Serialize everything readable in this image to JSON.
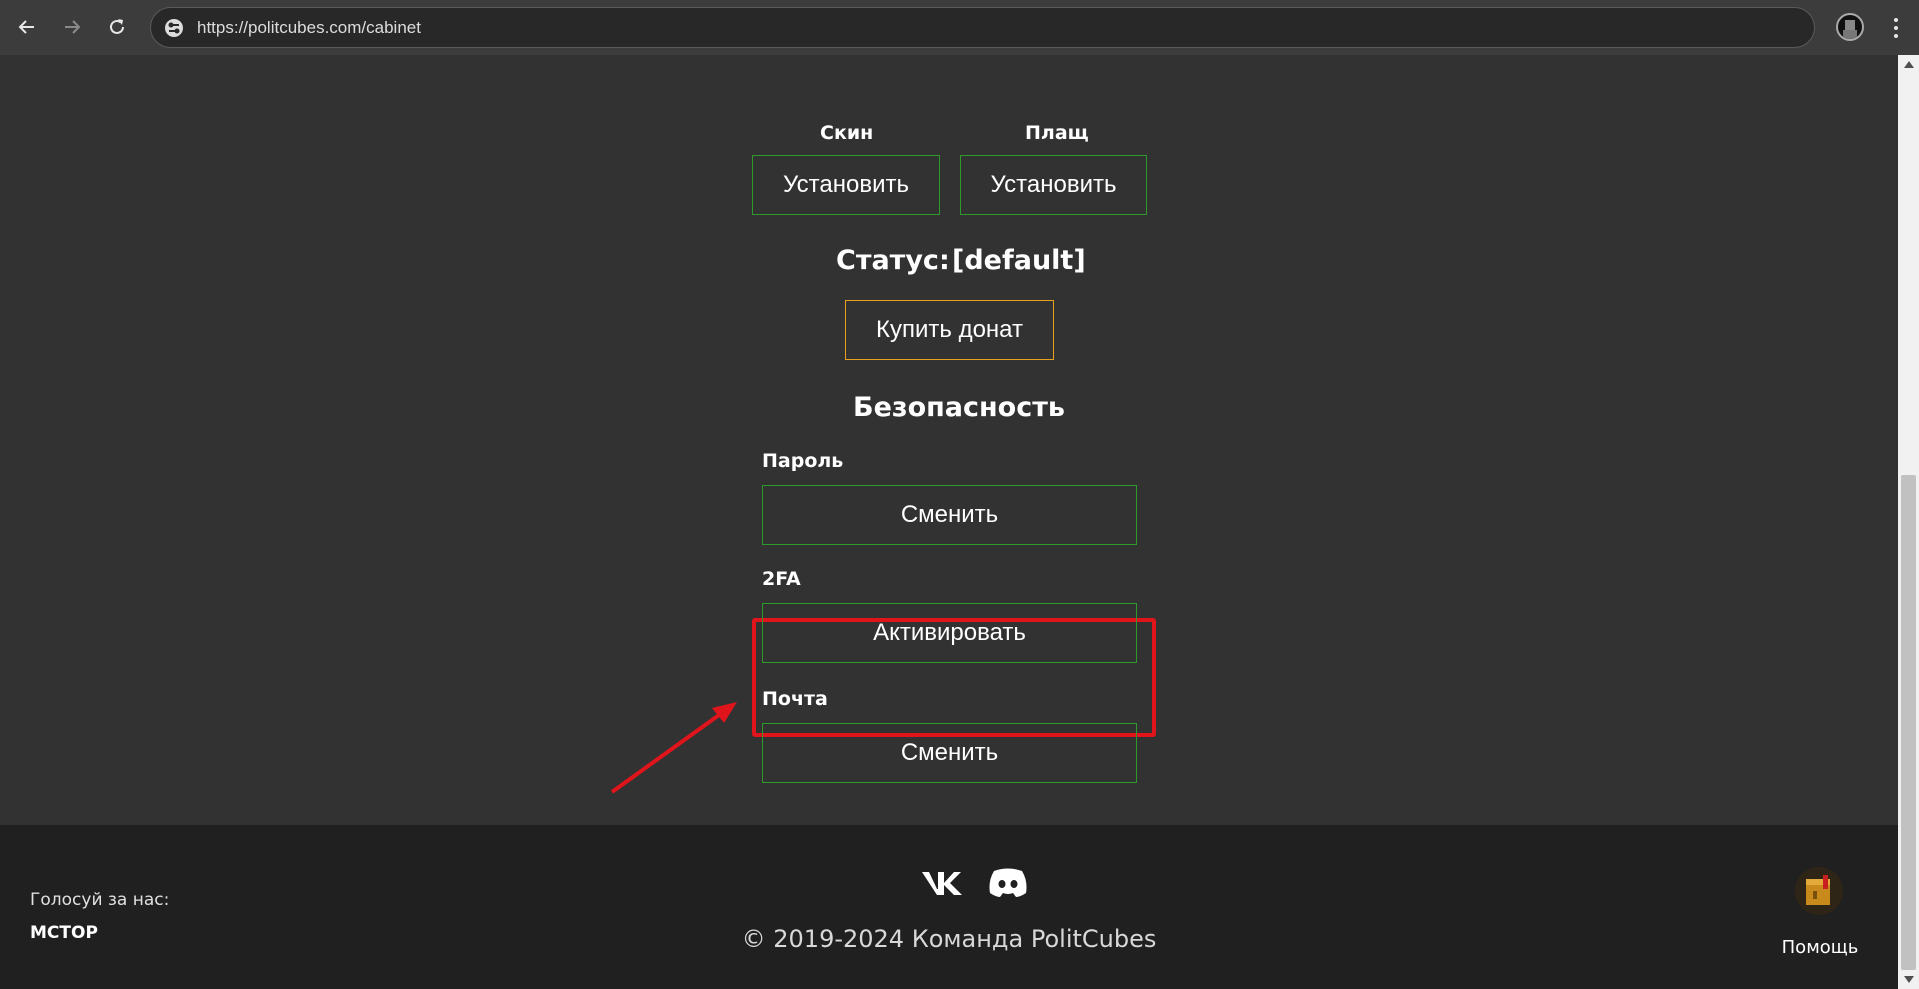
{
  "browser": {
    "url": "https://politcubes.com/cabinet"
  },
  "appearance": {
    "skin_label": "Скин",
    "skin_button": "Установить",
    "cloak_label": "Плащ",
    "cloak_button": "Установить"
  },
  "status": {
    "label": "Статус:",
    "value": "[default]",
    "donate_button": "Купить донат"
  },
  "security": {
    "heading": "Безопасность",
    "password_label": "Пароль",
    "password_button": "Сменить",
    "twofa_label": "2FA",
    "twofa_button": "Активировать",
    "email_label": "Почта",
    "email_button": "Сменить"
  },
  "footer": {
    "vote_label": "Голосуй за нас:",
    "vote_link": "MCTOP",
    "copyright": "© 2019-2024 Команда PolitCubes",
    "help_label": "Помощь"
  },
  "colors": {
    "background": "#323232",
    "footer_background": "#202020",
    "green_border": "#2e9a2e",
    "orange_border": "#e6a21f",
    "highlight": "#e0141b"
  }
}
